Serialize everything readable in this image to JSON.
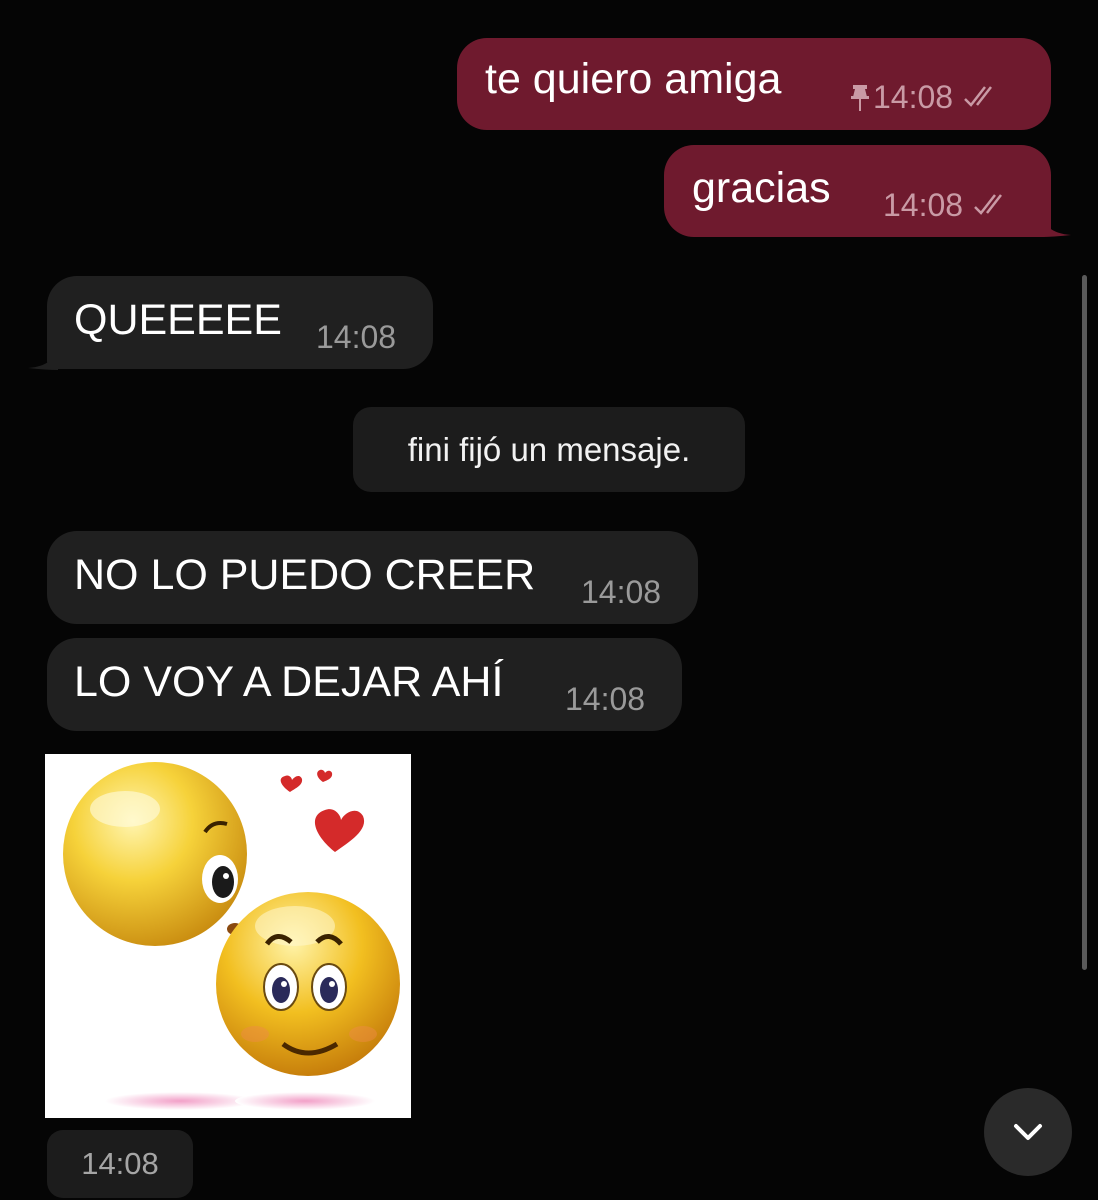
{
  "messages": [
    {
      "text": "te quiero amiga",
      "time": "14:08",
      "direction": "outgoing",
      "pinned": true,
      "read": true
    },
    {
      "text": "gracias",
      "time": "14:08",
      "direction": "outgoing",
      "pinned": false,
      "read": true
    },
    {
      "text": "QUEEEEE",
      "time": "14:08",
      "direction": "incoming"
    },
    {
      "text": "NO LO PUEDO CREER",
      "time": "14:08",
      "direction": "incoming"
    },
    {
      "text": "LO VOY A DEJAR AHÍ",
      "time": "14:08",
      "direction": "incoming"
    }
  ],
  "service_message": "fini fijó un mensaje.",
  "photo_message": {
    "time": "14:08",
    "icons": [
      "kissing-emoji-icon",
      "blushing-emoji-icon",
      "heart-icon"
    ]
  },
  "icons": {
    "pin": "pin-icon",
    "read": "double-check-icon",
    "scroll": "chevron-down-icon"
  },
  "colors": {
    "background": "#050505",
    "outgoing_bubble": "#6f1a2e",
    "incoming_bubble": "#202020",
    "service_bubble": "#1c1c1c",
    "emoji_yellow": "#f2c61a",
    "heart_red": "#d42a2a"
  }
}
